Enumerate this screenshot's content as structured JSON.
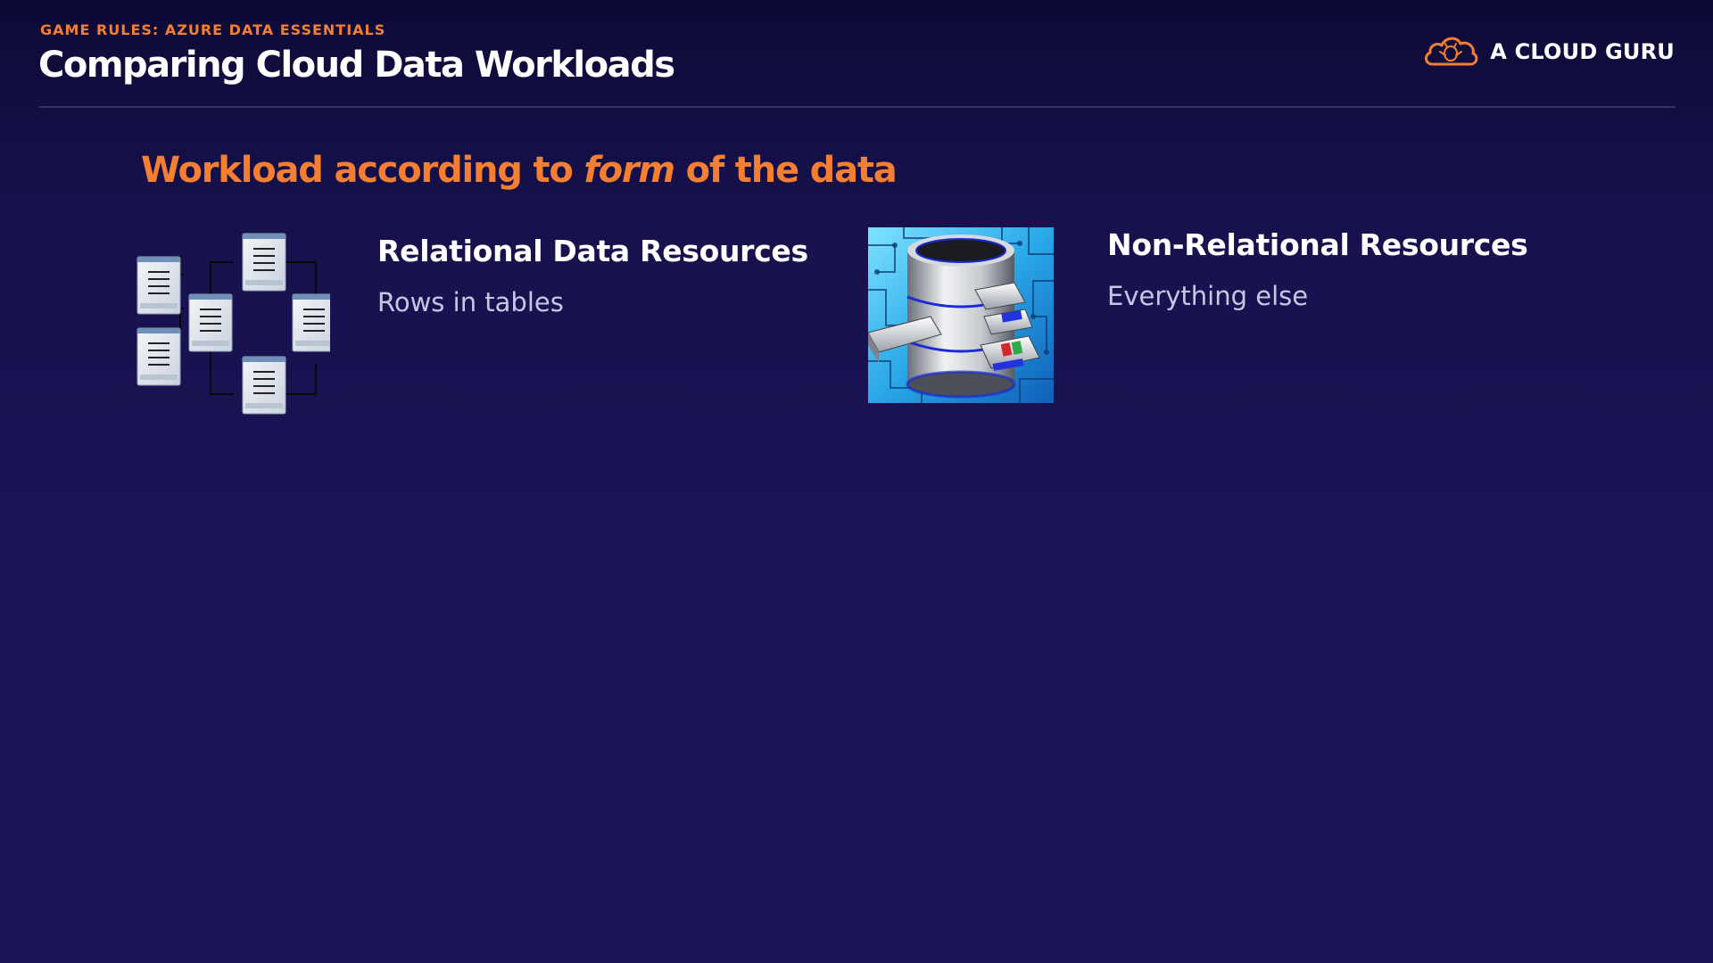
{
  "header": {
    "kicker": "GAME RULES: AZURE DATA ESSENTIALS",
    "title": "Comparing Cloud Data Workloads"
  },
  "brand": {
    "name": "A CLOUD GURU",
    "logo_icon": "cloud-logo-icon",
    "color": "#f47f32"
  },
  "subtitle": {
    "part1": "Workload according  to ",
    "emphasis": "form",
    "part2": " of the data"
  },
  "relational": {
    "title": "Relational Data Resources",
    "description": "Rows in tables",
    "icon": "relational-tables-diagram-icon"
  },
  "non_relational": {
    "title": "Non-Relational Resources",
    "description": "Everything else",
    "icon": "database-drawers-image"
  },
  "colors": {
    "background": "#1b1456",
    "accent": "#f47f32",
    "text": "#ffffff",
    "muted_text": "#c9c6e3"
  }
}
